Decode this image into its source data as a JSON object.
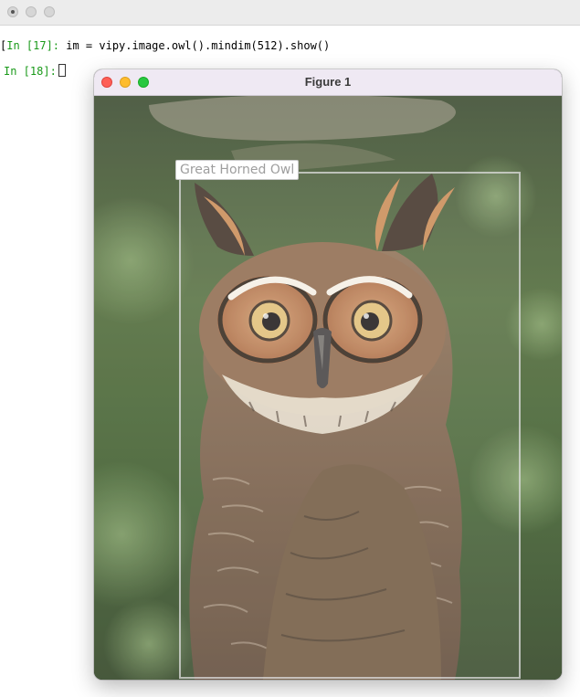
{
  "terminal": {
    "cells": [
      {
        "prompt": "In [17]:",
        "code": " im = vipy.image.owl().mindim(512).show()"
      },
      {
        "prompt": "In [18]:",
        "code": ""
      }
    ]
  },
  "figure_window": {
    "title": "Figure 1",
    "buttons": [
      "close",
      "minimize",
      "zoom"
    ],
    "image": {
      "subject": "great horned owl photograph",
      "bounding_box": {
        "label": "Great Horned Owl",
        "color": "#dcdcdc"
      }
    }
  },
  "colors": {
    "close": "#fe5f57",
    "minimize": "#febc2e",
    "zoom": "#28c840",
    "prompt": "#1a9a1a"
  }
}
